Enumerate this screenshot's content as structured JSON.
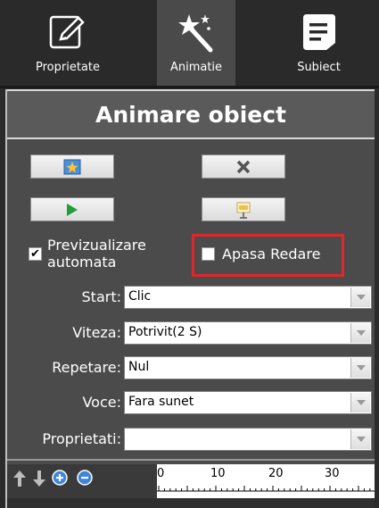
{
  "tabs": [
    {
      "label": "Proprietate",
      "icon": "edit-icon"
    },
    {
      "label": "Animatie",
      "icon": "magic-wand-icon"
    },
    {
      "label": "Subiect",
      "icon": "document-icon"
    }
  ],
  "panel": {
    "title": "Animare obiect",
    "buttons": [
      {
        "name": "add-animation-button",
        "icon": "add-effect-icon"
      },
      {
        "name": "delete-animation-button",
        "icon": "delete-icon"
      },
      {
        "name": "play-button",
        "icon": "play-icon"
      },
      {
        "name": "preview-button",
        "icon": "presentation-icon"
      }
    ],
    "auto_preview": {
      "label_line1": "Previzualizare",
      "label_line2": "automata",
      "checked": true
    },
    "press_play": {
      "label": "Apasa Redare",
      "checked": false
    },
    "fields": [
      {
        "label": "Start:",
        "value": "Clic"
      },
      {
        "label": "Viteza:",
        "value": "Potrivit(2 S)"
      },
      {
        "label": "Repetare:",
        "value": "Nul"
      },
      {
        "label": "Voce:",
        "value": "Fara sunet"
      },
      {
        "label": "Proprietati:",
        "value": ""
      }
    ]
  },
  "timeline": {
    "ruler_labels": [
      "0",
      "10",
      "20",
      "30"
    ]
  }
}
